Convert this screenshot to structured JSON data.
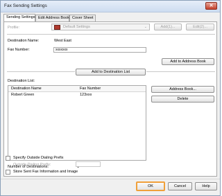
{
  "window": {
    "title": "Fax Sending Settings",
    "close_glyph": "✕"
  },
  "tabs": [
    {
      "label": "Sending Settings"
    },
    {
      "label": "Edit Address Book"
    },
    {
      "label": "Cover Sheet"
    }
  ],
  "profile": {
    "label": "Profile:",
    "value": "Default Settings",
    "add_label": "Add(1)...",
    "edit_label": "Edit(2)..."
  },
  "destination": {
    "name_label": "Destination Name:",
    "name_value": "West East",
    "fax_label": "Fax Number:",
    "fax_value": "xxxxxxx",
    "add_to_address_book": "Add to Address Book",
    "add_to_destination_list": "Add to Destination List"
  },
  "destination_list": {
    "label": "Destination List:",
    "columns": [
      "Destination Name",
      "Fax Number"
    ],
    "rows": [
      {
        "name": "Robert Green",
        "fax": "123xxx"
      }
    ],
    "address_book_button": "Address Book...",
    "delete_button": "Delete"
  },
  "count": {
    "label": "Number of Destinations:",
    "value": "1"
  },
  "options": {
    "outside_prefix_label": "Specify Outside Dialing Prefix",
    "outside_prefix_field_label": "Outside Dialing Prefix:",
    "store_label": "Store Sent Fax Information and Image"
  },
  "footer": {
    "ok": "OK",
    "cancel": "Cancel",
    "help": "Help"
  },
  "colors": {
    "highlight": "#f0a03a"
  }
}
